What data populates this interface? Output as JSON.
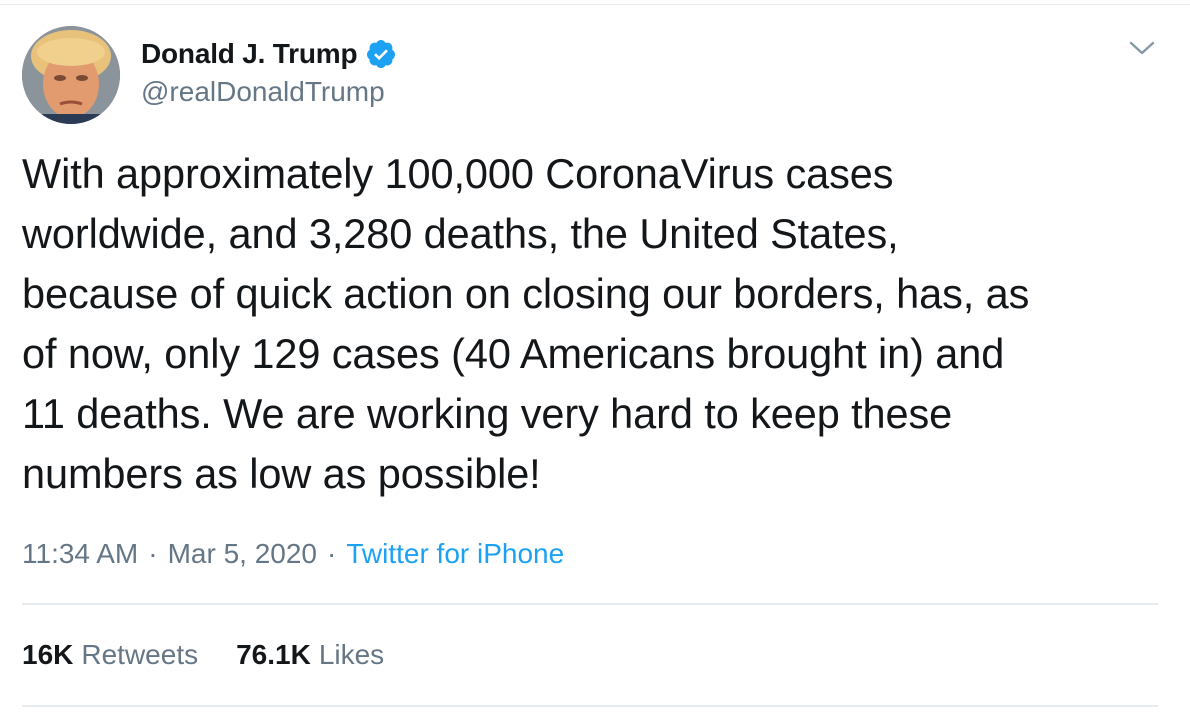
{
  "author": {
    "display_name": "Donald J. Trump",
    "handle": "@realDonaldTrump",
    "verified": true,
    "avatar_icon": "profile-photo"
  },
  "tweet": {
    "text": "With approximately 100,000 CoronaVirus cases\nworldwide, and 3,280 deaths, the United States,\nbecause of quick action on closing our borders, has, as\nof now, only 129 cases (40 Americans brought in) and\n11 deaths. We are working very hard to keep these\nnumbers as low as possible!",
    "time": "11:34 AM",
    "date": "Mar 5, 2020",
    "separator": "·",
    "source": "Twitter for iPhone"
  },
  "stats": {
    "retweets_count": "16K",
    "retweets_label": "Retweets",
    "likes_count": "76.1K",
    "likes_label": "Likes"
  },
  "colors": {
    "accent": "#1da1f2",
    "text": "#14171a",
    "secondary": "#657786",
    "border": "#e6ecf0"
  },
  "icons": {
    "verified": "verified-badge-icon",
    "menu": "chevron-down-icon"
  }
}
